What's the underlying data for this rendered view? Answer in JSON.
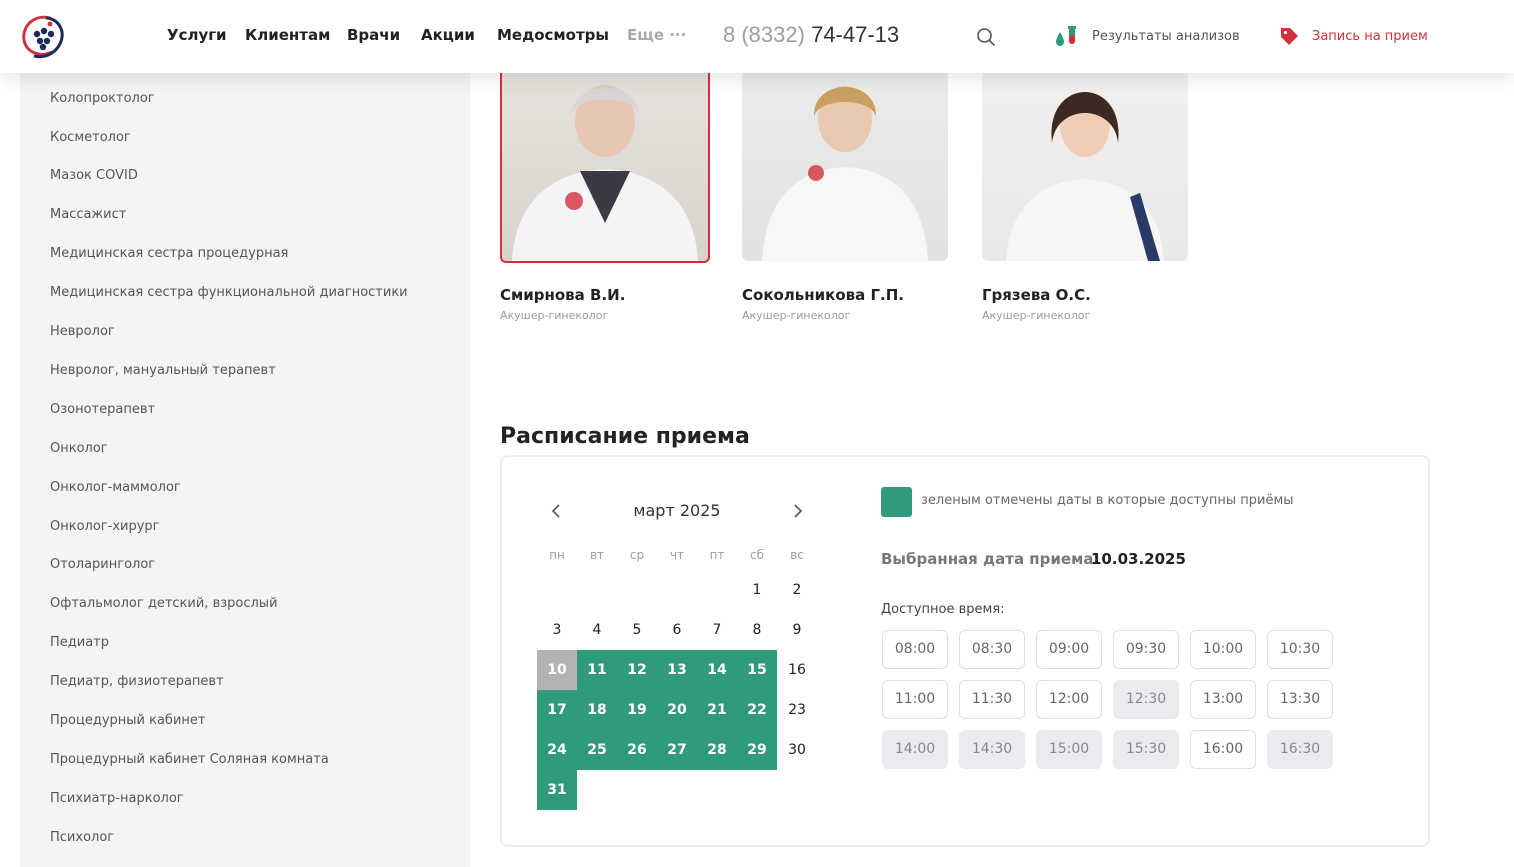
{
  "header": {
    "nav": [
      {
        "label": "Услуги"
      },
      {
        "label": "Клиентам"
      },
      {
        "label": "Врачи"
      },
      {
        "label": "Акции"
      },
      {
        "label": "Медосмотры"
      },
      {
        "label": "Еще ···"
      }
    ],
    "phone_code": "8 (8332)",
    "phone_number": "74-47-13",
    "results_label": "Результаты анализов",
    "booking_label": "Запись на прием"
  },
  "sidebar": {
    "items": [
      "Колопроктолог",
      "Косметолог",
      "Мазок COVID",
      "Массажист",
      "Медицинская сестра процедурная",
      "Медицинская сестра функциональной диагностики",
      "Невролог",
      "Невролог, мануальный терапевт",
      "Озонотерапевт",
      "Онколог",
      "Онколог-маммолог",
      "Онколог-хирург",
      "Отоларинголог",
      "Офтальмолог детский, взрослый",
      "Педиатр",
      "Педиатр, физиотерапевт",
      "Процедурный кабинет",
      "Процедурный кабинет Соляная комната",
      "Психиатр-нарколог",
      "Психолог"
    ]
  },
  "doctors": [
    {
      "name": "Смирнова В.И.",
      "specialty": "Акушер-гинеколог",
      "selected": true
    },
    {
      "name": "Сокольникова Г.П.",
      "specialty": "Акушер-гинеколог",
      "selected": false
    },
    {
      "name": "Грязева О.С.",
      "specialty": "Акушер-гинеколог",
      "selected": false
    }
  ],
  "schedule": {
    "title": "Расписание приема",
    "month": "март 2025",
    "weekdays": [
      "пн",
      "вт",
      "ср",
      "чт",
      "пт",
      "сб",
      "вс"
    ],
    "days": [
      {
        "d": "1",
        "state": "none"
      },
      {
        "d": "2",
        "state": "none"
      },
      {
        "d": "3",
        "state": "none"
      },
      {
        "d": "4",
        "state": "none"
      },
      {
        "d": "5",
        "state": "none"
      },
      {
        "d": "6",
        "state": "none"
      },
      {
        "d": "7",
        "state": "none"
      },
      {
        "d": "8",
        "state": "none"
      },
      {
        "d": "9",
        "state": "none"
      },
      {
        "d": "10",
        "state": "selected"
      },
      {
        "d": "11",
        "state": "available"
      },
      {
        "d": "12",
        "state": "available"
      },
      {
        "d": "13",
        "state": "available"
      },
      {
        "d": "14",
        "state": "available"
      },
      {
        "d": "15",
        "state": "available"
      },
      {
        "d": "16",
        "state": "none"
      },
      {
        "d": "17",
        "state": "available"
      },
      {
        "d": "18",
        "state": "available"
      },
      {
        "d": "19",
        "state": "available"
      },
      {
        "d": "20",
        "state": "available"
      },
      {
        "d": "21",
        "state": "available"
      },
      {
        "d": "22",
        "state": "available"
      },
      {
        "d": "23",
        "state": "none"
      },
      {
        "d": "24",
        "state": "available"
      },
      {
        "d": "25",
        "state": "available"
      },
      {
        "d": "26",
        "state": "available"
      },
      {
        "d": "27",
        "state": "available"
      },
      {
        "d": "28",
        "state": "available"
      },
      {
        "d": "29",
        "state": "available"
      },
      {
        "d": "30",
        "state": "none"
      },
      {
        "d": "31",
        "state": "available"
      }
    ],
    "legend": "зеленым отмечены даты в которые доступны приёмы",
    "selected_label": "Выбранная дата приема:",
    "selected_value": "10.03.2025",
    "times_label": "Доступное время:",
    "slots": [
      {
        "t": "08:00",
        "busy": false
      },
      {
        "t": "08:30",
        "busy": false
      },
      {
        "t": "09:00",
        "busy": false
      },
      {
        "t": "09:30",
        "busy": false
      },
      {
        "t": "10:00",
        "busy": false
      },
      {
        "t": "10:30",
        "busy": false
      },
      {
        "t": "11:00",
        "busy": false
      },
      {
        "t": "11:30",
        "busy": false
      },
      {
        "t": "12:00",
        "busy": false
      },
      {
        "t": "12:30",
        "busy": true
      },
      {
        "t": "13:00",
        "busy": false
      },
      {
        "t": "13:30",
        "busy": false
      },
      {
        "t": "14:00",
        "busy": true
      },
      {
        "t": "14:30",
        "busy": true
      },
      {
        "t": "15:00",
        "busy": true
      },
      {
        "t": "15:30",
        "busy": true
      },
      {
        "t": "16:00",
        "busy": false
      },
      {
        "t": "16:30",
        "busy": true
      }
    ]
  },
  "colors": {
    "accent_red": "#d0313e",
    "available_green": "#2f9b7c",
    "selected_gray": "#b3b3b3"
  }
}
